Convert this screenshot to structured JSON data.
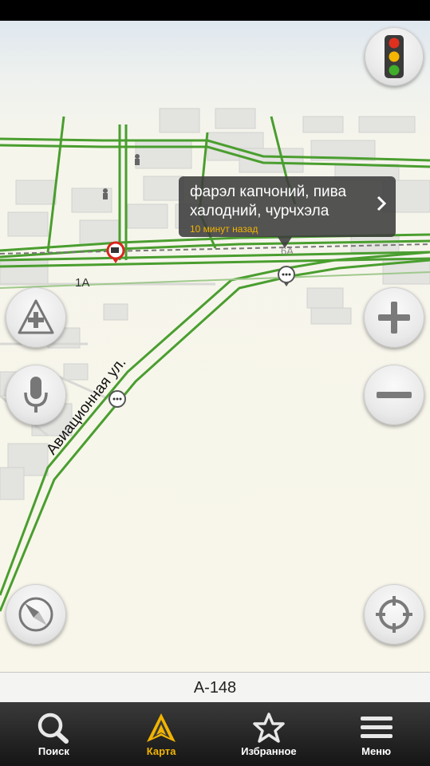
{
  "map": {
    "street_label": "Авиационная ул.",
    "house_labels": [
      "1А",
      "6А"
    ],
    "street_label_top": "Авиационная ул."
  },
  "popup": {
    "line1": "фарэл капчоний, пива",
    "line2": "халодний, чурчхэла",
    "time": "10 минут назад"
  },
  "controls": {
    "traffic": "traffic-light-icon",
    "add_event": "add-road-event-icon",
    "voice": "microphone-icon",
    "zoom_in": "plus-icon",
    "zoom_out": "minus-icon",
    "compass": "compass-icon",
    "locate": "crosshair-icon"
  },
  "road_bar": {
    "name": "А-148"
  },
  "tabs": [
    {
      "label": "Поиск",
      "icon": "search-icon"
    },
    {
      "label": "Карта",
      "icon": "navigation-arrow-icon",
      "active": true
    },
    {
      "label": "Избранное",
      "icon": "star-icon"
    },
    {
      "label": "Меню",
      "icon": "menu-icon"
    }
  ],
  "colors": {
    "accent": "#f2b400",
    "road_green": "#4a9e2f"
  }
}
